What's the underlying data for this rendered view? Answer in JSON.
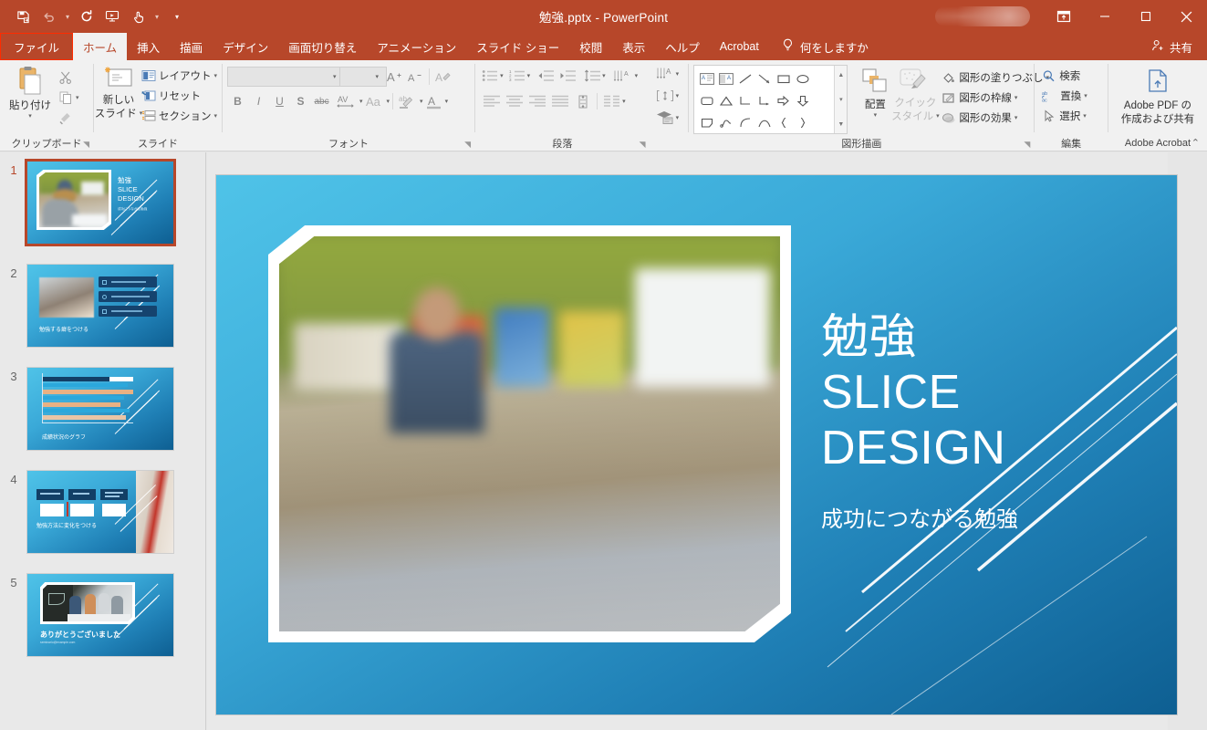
{
  "titlebar": {
    "document_title": "勉強.pptx  -  PowerPoint",
    "quick_access": [
      {
        "name": "save-icon",
        "label": "上書き保存"
      },
      {
        "name": "undo-icon",
        "label": "元に戻す"
      },
      {
        "name": "redo-icon",
        "label": "やり直し"
      },
      {
        "name": "start-slideshow-icon",
        "label": "最初から開始"
      },
      {
        "name": "touch-mode-icon",
        "label": "タッチ/マウス モードの切り替え"
      },
      {
        "name": "customize-qat-icon",
        "label": "クイック アクセス ツール バーのユーザー設定"
      }
    ],
    "ribbon_display_label": "リボンの表示オプション",
    "minimize_label": "最小化",
    "maximize_label": "最大化",
    "close_label": "閉じる"
  },
  "tabs": [
    {
      "label": "ファイル",
      "active": false,
      "file": true
    },
    {
      "label": "ホーム",
      "active": true
    },
    {
      "label": "挿入",
      "active": false
    },
    {
      "label": "描画",
      "active": false
    },
    {
      "label": "デザイン",
      "active": false
    },
    {
      "label": "画面切り替え",
      "active": false
    },
    {
      "label": "アニメーション",
      "active": false
    },
    {
      "label": "スライド ショー",
      "active": false
    },
    {
      "label": "校閲",
      "active": false
    },
    {
      "label": "表示",
      "active": false
    },
    {
      "label": "ヘルプ",
      "active": false
    },
    {
      "label": "Acrobat",
      "active": false
    }
  ],
  "tellme": {
    "label": "何をしますか",
    "icon": "lightbulb-icon"
  },
  "share": {
    "label": "共有",
    "icon": "share-person-icon"
  },
  "ribbon": {
    "groups": [
      {
        "name": "clipboard",
        "label": "クリップボード",
        "has_dialog_launcher": true,
        "paste": {
          "label": "貼り付け",
          "caret": "▾"
        },
        "items": [
          {
            "name": "cut-button",
            "label": "切り取り"
          },
          {
            "name": "copy-button",
            "label": "コピー"
          },
          {
            "name": "format-painter-button",
            "label": "書式のコピー/貼り付け"
          }
        ]
      },
      {
        "name": "slides",
        "label": "スライド",
        "has_dialog_launcher": false,
        "new_slide": {
          "label_line1": "新しい",
          "label_line2": "スライド",
          "caret": "▾"
        },
        "items": [
          {
            "name": "layout-button",
            "label": "レイアウト",
            "caret": "▾"
          },
          {
            "name": "reset-button",
            "label": "リセット",
            "caret": ""
          },
          {
            "name": "section-button",
            "label": "セクション",
            "caret": "▾"
          }
        ]
      },
      {
        "name": "font",
        "label": "フォント",
        "has_dialog_launcher": true,
        "font_name_value": "",
        "font_size_value": "",
        "items": [
          {
            "name": "increase-font-size-button",
            "label": "A"
          },
          {
            "name": "decrease-font-size-button",
            "label": "A"
          },
          {
            "name": "clear-formatting-button",
            "label": "すべての書式をクリア"
          },
          {
            "name": "bold-button",
            "label": "B"
          },
          {
            "name": "italic-button",
            "label": "I"
          },
          {
            "name": "underline-button",
            "label": "U"
          },
          {
            "name": "shadow-button",
            "label": "S"
          },
          {
            "name": "strikethrough-button",
            "label": "abc"
          },
          {
            "name": "character-spacing-button",
            "label": "AV"
          },
          {
            "name": "change-case-button",
            "label": "Aa"
          },
          {
            "name": "text-highlight-color-button",
            "label": "ab"
          },
          {
            "name": "font-color-button",
            "label": "A"
          }
        ]
      },
      {
        "name": "paragraph",
        "label": "段落",
        "has_dialog_launcher": true,
        "items": [
          {
            "name": "bullets-button",
            "label": "箇条書き"
          },
          {
            "name": "numbering-button",
            "label": "段落番号"
          },
          {
            "name": "decrease-indent-button",
            "label": "インデントを減らす"
          },
          {
            "name": "increase-indent-button",
            "label": "インデントを増やす"
          },
          {
            "name": "line-spacing-button",
            "label": "行間"
          },
          {
            "name": "text-direction-button",
            "label": "文字列の方向"
          },
          {
            "name": "align-text-button",
            "label": "文字の配置"
          },
          {
            "name": "convert-smartart-button",
            "label": "SmartArt に変換"
          },
          {
            "name": "align-left-button",
            "label": "左揃え"
          },
          {
            "name": "align-center-button",
            "label": "中央揃え"
          },
          {
            "name": "align-right-button",
            "label": "右揃え"
          },
          {
            "name": "justify-button",
            "label": "両端揃え"
          },
          {
            "name": "columns-button",
            "label": "段組み"
          }
        ]
      },
      {
        "name": "drawing",
        "label": "図形描画",
        "has_dialog_launcher": true,
        "arrange": {
          "label": "配置",
          "caret": "▾"
        },
        "quick_styles": {
          "label_line1": "クイック",
          "label_line2": "スタイル",
          "caret": "▾"
        },
        "items": [
          {
            "name": "shape-fill-button",
            "label": "図形の塗りつぶし",
            "caret": "▾"
          },
          {
            "name": "shape-outline-button",
            "label": "図形の枠線",
            "caret": "▾"
          },
          {
            "name": "shape-effects-button",
            "label": "図形の効果",
            "caret": "▾"
          }
        ]
      },
      {
        "name": "editing",
        "label": "編集",
        "has_dialog_launcher": false,
        "items": [
          {
            "name": "find-button",
            "label": "検索",
            "caret": ""
          },
          {
            "name": "replace-button",
            "label": "置換",
            "caret": "▾"
          },
          {
            "name": "select-button",
            "label": "選択",
            "caret": "▾"
          }
        ]
      },
      {
        "name": "adobe-acrobat",
        "label": "Adobe Acrobat",
        "has_dialog_launcher": false,
        "create_pdf": {
          "label_line1": "Adobe PDF の",
          "label_line2": "作成および共有"
        }
      }
    ],
    "collapse_ribbon_label": "リボンを折りたたむ"
  },
  "thumbnails": [
    {
      "number": "1",
      "selected": true,
      "title": "勉強\nSLICE\nDESIGN",
      "caption": "成功につながる勉強"
    },
    {
      "number": "2",
      "selected": false,
      "title": "",
      "caption": "勉強する癖をつける"
    },
    {
      "number": "3",
      "selected": false,
      "title": "",
      "caption": "成績状況のグラフ"
    },
    {
      "number": "4",
      "selected": false,
      "title": "",
      "caption": "勉強方法に変化をつける"
    },
    {
      "number": "5",
      "selected": false,
      "title": "",
      "caption": "ありがとうございました"
    }
  ],
  "slide": {
    "title_lines": [
      "勉強",
      "SLICE",
      "DESIGN"
    ],
    "subtitle": "成功につながる勉強",
    "photo_alt": "教室で鉛筆を持って勉強する男の子"
  },
  "scrollbar": {
    "up_arrow": "▲",
    "down_arrow": "▼",
    "prev_slide": "▲",
    "next_slide": "▼"
  },
  "colors": {
    "brand_red": "#b7472a",
    "file_tab_outline": "#ff2b00",
    "ribbon_bg": "#f1f1f1",
    "pane_bg": "#e9e9e9",
    "slide_gradient_from": "#4fc3e8",
    "slide_gradient_to": "#0e5f92",
    "selection_border": "#b7472a"
  }
}
